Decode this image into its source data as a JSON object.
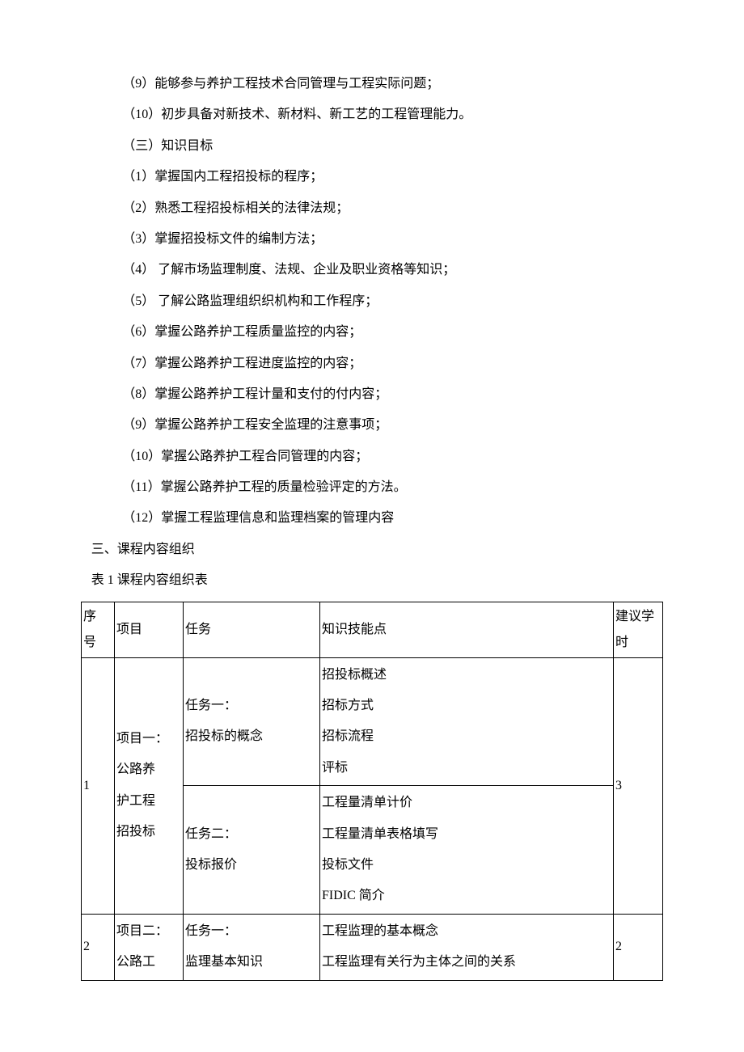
{
  "paragraphs": {
    "p9": "（9）能够参与养护工程技术合同管理与工程实际问题；",
    "p10": "（10）初步具备对新技术、新材料、新工艺的工程管理能力。",
    "h3": "（三）知识目标",
    "k1": "（1）掌握国内工程招投标的程序；",
    "k2": "（2）熟悉工程招投标相关的法律法规；",
    "k3": "（3）掌握招投标文件的编制方法；",
    "k4": "（4）  了解市场监理制度、法规、企业及职业资格等知识；",
    "k5": "（5）  了解公路监理组织织机构和工作程序；",
    "k6": "（6）掌握公路养护工程质量监控的内容；",
    "k7": "（7）掌握公路养护工程进度监控的内容；",
    "k8": "（8）掌握公路养护工程计量和支付的付内容；",
    "k9": "（9）掌握公路养护工程安全监理的注意事项；",
    "k10": "（10）掌握公路养护工程合同管理的内容；",
    "k11": "（11）掌握公路养护工程的质量检验评定的方法。",
    "k12": "（12）掌握工程监理信息和监理档案的管理内容",
    "section3": "三、课程内容组织",
    "tableCaption": "表 1 课程内容组织表"
  },
  "chart_data": {
    "type": "table",
    "title": "表 1 课程内容组织表",
    "columns": [
      "序号",
      "项目",
      "任务",
      "知识技能点",
      "建议学时"
    ],
    "rows": [
      {
        "序号": "1",
        "项目": "项目一：公路养护工程招投标",
        "任务": "任务一：招投标的概念",
        "知识技能点": [
          "招投标概述",
          "招标方式",
          "招标流程",
          "评标"
        ],
        "建议学时": "3"
      },
      {
        "序号": "1",
        "项目": "项目一：公路养护工程招投标",
        "任务": "任务二：投标报价",
        "知识技能点": [
          "工程量清单计价",
          "工程量清单表格填写",
          "投标文件",
          "FIDIC 简介"
        ],
        "建议学时": "3"
      },
      {
        "序号": "2",
        "项目": "项目二：公路工",
        "任务": "任务一：监理基本知识",
        "知识技能点": [
          "工程监理的基本概念",
          "工程监理有关行为主体之间的关系"
        ],
        "建议学时": "2"
      }
    ]
  },
  "table": {
    "header": {
      "seq_l1": "序",
      "seq_l2": "号",
      "proj": "项目",
      "task": "任务",
      "knowledge": "知识技能点",
      "hours_l1": "建议学",
      "hours_l2": "时"
    },
    "row1": {
      "seq": "1",
      "proj_l1": "项目一：",
      "proj_l2": "公路养",
      "proj_l3": "护工程",
      "proj_l4": "招投标",
      "task1_l1": "任务一：",
      "task1_l2": "招投标的概念",
      "k1_l1": "招投标概述",
      "k1_l2": "招标方式",
      "k1_l3": "招标流程",
      "k1_l4": "评标",
      "task2_l1": "任务二：",
      "task2_l2": "投标报价",
      "k2_l1": "工程量清单计价",
      "k2_l2": "工程量清单表格填写",
      "k2_l3": "投标文件",
      "k2_l4": "FIDIC 简介",
      "hours": "3"
    },
    "row2": {
      "seq": "2",
      "proj_l1": "项目二：",
      "proj_l2": "公路工",
      "task1_l1": "任务一：",
      "task1_l2": "监理基本知识",
      "k1_l1": "工程监理的基本概念",
      "k1_l2": "工程监理有关行为主体之间的关系",
      "hours": "2"
    }
  }
}
